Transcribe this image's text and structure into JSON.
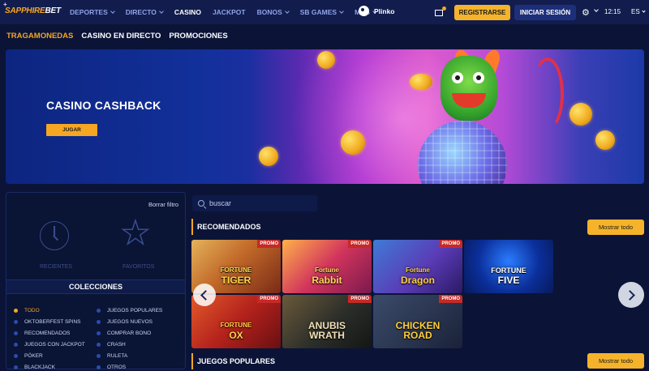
{
  "brand": {
    "part1": "SAPPHIRE",
    "part2": "BET"
  },
  "nav": [
    {
      "label": "DEPORTES",
      "dropdown": true
    },
    {
      "label": "DIRECTO",
      "dropdown": true
    },
    {
      "label": "CASINO",
      "dropdown": false,
      "active": true
    },
    {
      "label": "JACKPOT",
      "dropdown": false
    },
    {
      "label": "BONOS",
      "dropdown": true
    },
    {
      "label": "SB GAMES",
      "dropdown": true
    },
    {
      "label": "MÁS",
      "dropdown": true
    }
  ],
  "plinko_label": "Plinko",
  "register_label": "REGISTRARSE",
  "login_label": "INICIAR SESIÓN",
  "clock": "12:15",
  "language": "ES",
  "subnav": [
    "TRAGAMONEDAS",
    "CASINO EN DIRECTO",
    "PROMOCIONES"
  ],
  "banner": {
    "title": "CASINO CASHBACK",
    "button": "JUGAR"
  },
  "sidebar": {
    "clear_filter": "Borrar filtro",
    "recent_label": "RECIENTES",
    "favorites_label": "FAVORITOS",
    "collections_title": "COLECCIONES",
    "collections": [
      "TODO",
      "JUEGOS POPULARES",
      "OKTOBERFEST SPINS",
      "JUEGOS NUEVOS",
      "RECOMENDADOS",
      "COMPRAR BONO",
      "JUEGOS CON JACKPOT",
      "CRASH",
      "PÓKER",
      "RULETA",
      "BLACKJACK",
      "OTROS"
    ]
  },
  "search": {
    "placeholder": "buscar"
  },
  "sections": {
    "recommended": "RECOMENDADOS",
    "popular": "JUEGOS POPULARES",
    "show_all": "Mostrar todo"
  },
  "games": [
    {
      "title": "Fortune Tiger",
      "line1": "FORTUNE",
      "line2": "TIGER",
      "promo": "PROMO"
    },
    {
      "title": "Fortune Rabbit",
      "line1": "Fortune",
      "line2": "Rabbit",
      "promo": "PROMO"
    },
    {
      "title": "Fortune Dragon",
      "line1": "Fortune",
      "line2": "Dragon",
      "promo": "PROMO"
    },
    {
      "title": "Fortune Five",
      "line1": "FORTUNE",
      "line2": "FIVE",
      "promo": ""
    },
    {
      "title": "Fortune Ox",
      "line1": "FORTUNE",
      "line2": "OX",
      "promo": "PROMO"
    },
    {
      "title": "Anubis Wrath",
      "line1": "ANUBIS",
      "line2": "WRATH",
      "promo": "PROMO"
    },
    {
      "title": "Chicken Road",
      "line1": "CHICKEN",
      "line2": "ROAD",
      "promo": "PROMO"
    }
  ],
  "colors": {
    "accent": "#f5a623",
    "navy": "#0b1437",
    "topbar": "#121d4d",
    "promo": "#c52a26"
  }
}
